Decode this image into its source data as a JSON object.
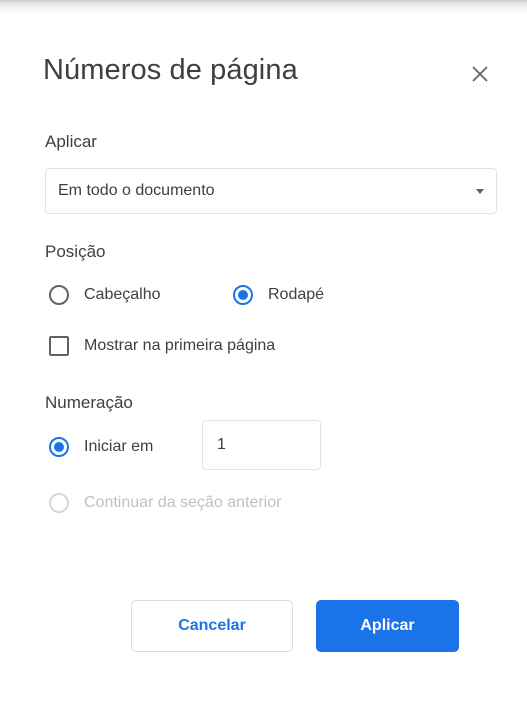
{
  "dialog": {
    "title": "Números de página",
    "close_icon": "close-icon"
  },
  "apply_section": {
    "label": "Aplicar",
    "select_value": "Em todo o documento",
    "dropdown_icon": "dropdown-arrow-icon"
  },
  "position_section": {
    "label": "Posição",
    "options": [
      {
        "label": "Cabeçalho",
        "checked": false
      },
      {
        "label": "Rodapé",
        "checked": true
      }
    ],
    "show_first_page_label": "Mostrar na primeira página",
    "show_first_page_checked": false
  },
  "numbering_section": {
    "label": "Numeração",
    "start_at_label": "Iniciar em",
    "start_at_checked": true,
    "start_at_value": "1",
    "continue_label": "Continuar da seção anterior",
    "continue_enabled": false
  },
  "buttons": {
    "cancel_label": "Cancelar",
    "apply_label": "Aplicar"
  },
  "colors": {
    "accent": "#1a73e8",
    "text": "#3c4043",
    "disabled": "#bdc1c6"
  }
}
